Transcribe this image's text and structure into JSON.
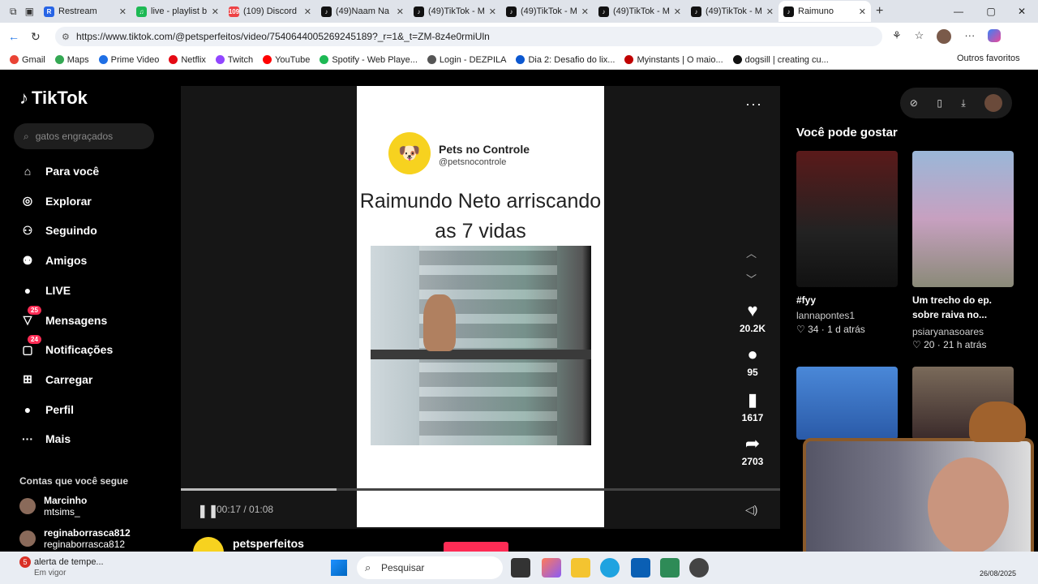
{
  "browser": {
    "tabs": [
      {
        "title": "Restream",
        "color": "#2764e5",
        "glyph": "R"
      },
      {
        "title": "live - playlist b",
        "color": "#1db954",
        "glyph": "♫"
      },
      {
        "title": "(109) Discord",
        "color": "#ed4245",
        "glyph": "109"
      },
      {
        "title": "(49)Naam Na",
        "color": "#111111",
        "glyph": "♪"
      },
      {
        "title": "(49)TikTok - M",
        "color": "#111111",
        "glyph": "♪"
      },
      {
        "title": "(49)TikTok - M",
        "color": "#111111",
        "glyph": "♪"
      },
      {
        "title": "(49)TikTok - M",
        "color": "#111111",
        "glyph": "♪"
      },
      {
        "title": "(49)TikTok - M",
        "color": "#111111",
        "glyph": "♪"
      },
      {
        "title": "Raimuno",
        "color": "#111111",
        "glyph": "♪"
      }
    ],
    "url": "https://www.tiktok.com/@petsperfeitos/video/7540644005269245189?_r=1&_t=ZM-8z4e0rmiUln",
    "bookmarks": [
      "Gmail",
      "Maps",
      "Prime Video",
      "Netflix",
      "Twitch",
      "YouTube",
      "Spotify - Web Playe...",
      "Login - DEZPILA",
      "Dia 2: Desafio do lix...",
      "Myinstants | O maio...",
      "dogsill | creating cu..."
    ],
    "bookmark_colors": [
      "#ea4335",
      "#34a853",
      "#1f6fe5",
      "#e50914",
      "#9146ff",
      "#ff0000",
      "#1db954",
      "#555555",
      "#0b57d0",
      "#c00000",
      "#111111"
    ],
    "other_favorites": "Outros favoritos"
  },
  "tiktok": {
    "logo": "TikTok",
    "search_placeholder": "gatos engraçados",
    "nav": [
      {
        "label": "Para você",
        "icon": "⌂"
      },
      {
        "label": "Explorar",
        "icon": "◎"
      },
      {
        "label": "Seguindo",
        "icon": "⚇"
      },
      {
        "label": "Amigos",
        "icon": "⚉"
      },
      {
        "label": "LIVE",
        "icon": "●"
      },
      {
        "label": "Mensagens",
        "icon": "▽",
        "badge": "25"
      },
      {
        "label": "Notificações",
        "icon": "▢",
        "badge": "24"
      },
      {
        "label": "Carregar",
        "icon": "⊞"
      },
      {
        "label": "Perfil",
        "icon": "●"
      },
      {
        "label": "Mais",
        "icon": "···"
      }
    ],
    "following_title": "Contas que você segue",
    "following": [
      {
        "name": "Marcinho",
        "handle": "mtsims_"
      },
      {
        "name": "reginaborrasca812",
        "handle": "reginaborrasca812"
      }
    ],
    "video": {
      "account_name": "Pets no Controle",
      "account_handle": "@petsnocontrole",
      "caption": "Raimundo Neto arriscando as 7 vidas",
      "time": "00:17 / 01:08",
      "progress": 0.26,
      "likes": "20.2K",
      "comments": "95",
      "saves": "1617",
      "shares": "2703",
      "bottom_user": "petsperfeitos"
    },
    "right": {
      "title": "Você pode gostar",
      "items": [
        {
          "caption": "#fyy",
          "author": "lannapontes1",
          "meta": "♡ 34 · 1 d atrás"
        },
        {
          "caption": "Um trecho do ep. sobre raiva no...",
          "author": "psiaryanasoares",
          "meta": "♡ 20 · 21 h atrás"
        }
      ]
    }
  },
  "taskbar": {
    "notification_title": "alerta de tempe...",
    "notification_sub": "Em vigor",
    "search": "Pesquisar",
    "date": "26/08/2025"
  }
}
